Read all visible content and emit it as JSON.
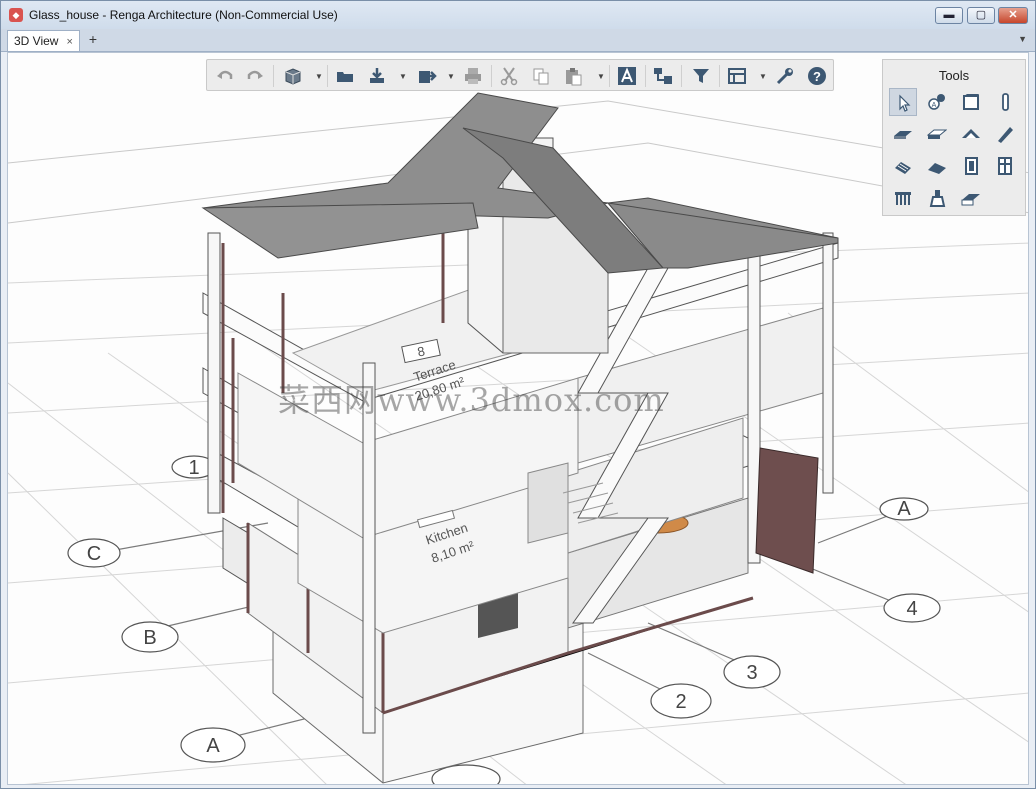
{
  "window": {
    "title": "Glass_house - Renga Architecture (Non-Commercial Use)",
    "buttons": {
      "minimize": "▬",
      "maximize": "▢",
      "close": "✕"
    }
  },
  "tabs": [
    {
      "label": "3D View",
      "close": "×",
      "active": true
    }
  ],
  "tab_add": "+",
  "tab_menu": "▼",
  "toolbar": {
    "buttons": [
      "undo-icon",
      "redo-icon",
      "view-cube-icon",
      "open-folder-icon",
      "import-icon",
      "export-icon",
      "print-icon",
      "cut-icon",
      "copy-icon",
      "paste-icon",
      "text-style-icon",
      "hierarchy-icon",
      "filter-icon",
      "level-visibility-icon",
      "settings-wrench-icon",
      "help-icon"
    ]
  },
  "tools_panel": {
    "title": "Tools",
    "items": [
      "select-icon",
      "axes-icon",
      "wall-icon",
      "column-icon",
      "slab-icon",
      "floor-icon",
      "roof-icon",
      "beam-icon",
      "stair-icon",
      "ramp-icon",
      "door-icon",
      "window-icon",
      "railing-icon",
      "equipment-icon",
      "opening-icon"
    ]
  },
  "scene": {
    "rooms": [
      {
        "number": "8",
        "name": "Terrace",
        "area": "20,80 m²"
      },
      {
        "name": "Kitchen",
        "area": "8,10 m²"
      }
    ],
    "axes_letters": [
      "A",
      "B",
      "C"
    ],
    "axes_numbers": [
      "1",
      "2",
      "3",
      "4"
    ],
    "watermark": "菜西网www.3dmox.com",
    "colors": {
      "roof": "#8f8f8f",
      "frame": "#6b4b4b",
      "door": "#6e4e4e",
      "wall": "#f4f4f4"
    }
  }
}
